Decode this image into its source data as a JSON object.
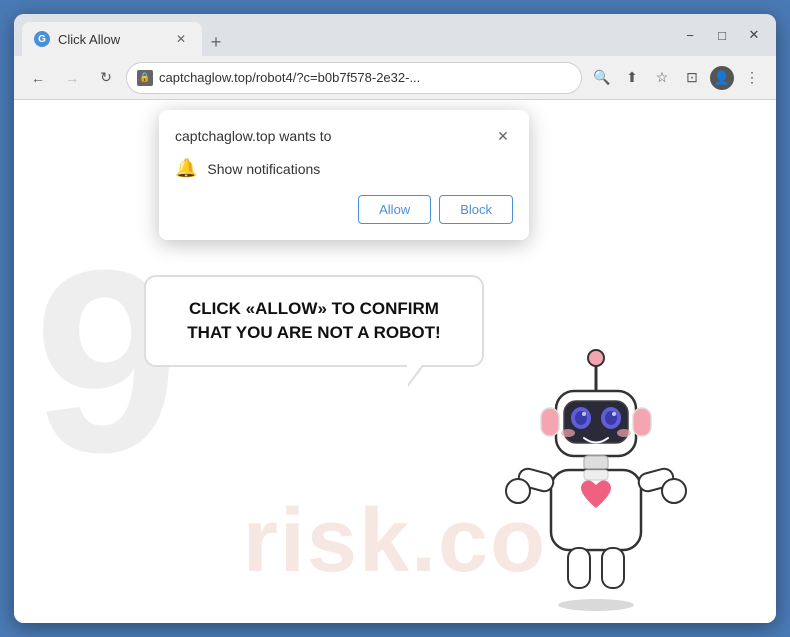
{
  "browser": {
    "tab": {
      "title": "Click Allow",
      "favicon_letter": "G"
    },
    "tab_new_label": "+",
    "window_controls": {
      "minimize": "−",
      "maximize": "□",
      "close": "✕"
    },
    "nav": {
      "back": "←",
      "forward": "→",
      "refresh": "↻",
      "address": "captchaglow.top/robot4/?c=b0b7f578-2e32-...",
      "search_icon": "🔍",
      "share_icon": "⬆",
      "bookmark_icon": "☆",
      "split_icon": "⊡",
      "profile_icon": "👤",
      "menu_icon": "⋮"
    }
  },
  "popup": {
    "title": "captchaglow.top wants to",
    "close_label": "✕",
    "notification_text": "Show notifications",
    "allow_label": "Allow",
    "block_label": "Block"
  },
  "page": {
    "bubble_text": "CLICK «ALLOW» TO CONFIRM THAT YOU ARE NOT A ROBOT!",
    "watermark": "risk.co"
  }
}
